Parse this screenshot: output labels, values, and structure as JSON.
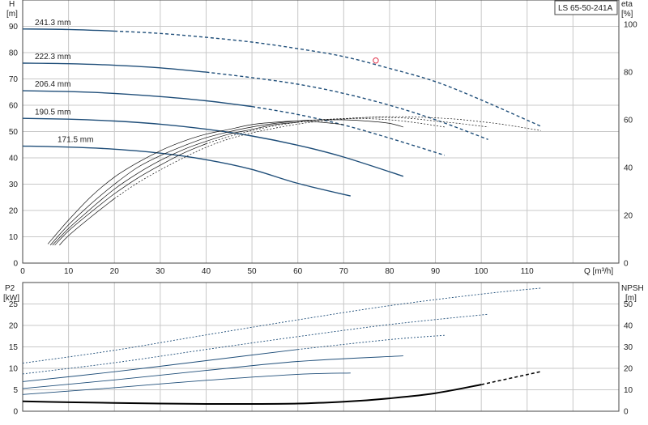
{
  "model_label": "LS 65-50-241A",
  "chart_data": [
    {
      "type": "line",
      "panel": "head-efficiency",
      "ylabel": "H",
      "yunit": "[m]",
      "y2label": "eta",
      "y2unit": "[%]",
      "xlabel": "Q [m³/h]",
      "xlim": [
        0,
        130
      ],
      "ylim": [
        0,
        100
      ],
      "y2lim": [
        0,
        100
      ],
      "x_ticks": [
        "0",
        "10",
        "20",
        "30",
        "40",
        "50",
        "60",
        "70",
        "80",
        "90",
        "100",
        "110"
      ],
      "y_ticks": [
        "0",
        "10",
        "20",
        "30",
        "40",
        "50",
        "60",
        "70",
        "80",
        "90"
      ],
      "y2_ticks": [
        "0",
        "20",
        "40",
        "60",
        "80",
        "100"
      ],
      "grid": true,
      "series": [
        {
          "name": "241.3 mm",
          "q": [
            0,
            10,
            20,
            30,
            40,
            50,
            60,
            70,
            80,
            90,
            100,
            113
          ],
          "h": [
            89,
            88.8,
            88.2,
            87.3,
            85.8,
            84,
            81.5,
            78.5,
            74,
            69,
            62,
            52
          ],
          "solid_to": 20
        },
        {
          "name": "222.3 mm",
          "q": [
            0,
            10,
            20,
            30,
            40,
            50,
            60,
            70,
            80,
            90,
            101.5
          ],
          "h": [
            76,
            75.8,
            75.2,
            74.2,
            72.6,
            70.5,
            68,
            64.5,
            60,
            54.5,
            47
          ],
          "solid_to": 40
        },
        {
          "name": "206.4 mm",
          "q": [
            0,
            10,
            20,
            30,
            40,
            50,
            60,
            70,
            80,
            92
          ],
          "h": [
            65.5,
            65.2,
            64.5,
            63.3,
            61.7,
            59.5,
            56.5,
            52.5,
            47.5,
            41
          ],
          "solid_to": 50
        },
        {
          "name": "190.5 mm",
          "q": [
            0,
            10,
            20,
            30,
            40,
            50,
            60,
            70,
            83
          ],
          "h": [
            55,
            54.7,
            54,
            52.8,
            50.9,
            48.3,
            44.8,
            40.3,
            33
          ],
          "solid_to": 83
        },
        {
          "name": "171.5 mm",
          "q": [
            0,
            10,
            20,
            30,
            40,
            50,
            60,
            71.5
          ],
          "h": [
            44.5,
            44.1,
            43.3,
            41.8,
            39.3,
            35.6,
            30.3,
            25.5
          ],
          "solid_to": 71.5
        }
      ],
      "efficiency_series": [
        {
          "q": [
            5.5,
            10,
            15,
            20,
            25,
            30,
            35,
            40,
            45,
            50,
            55,
            60,
            65,
            70
          ],
          "eta": [
            8,
            18,
            28,
            36,
            42,
            47,
            51,
            54,
            56,
            58,
            59,
            59.5,
            59,
            58
          ],
          "solid_to": 70
        },
        {
          "q": [
            6,
            10,
            15,
            20,
            25,
            30,
            35,
            40,
            45,
            50,
            55,
            60,
            65,
            70,
            75,
            80,
            83
          ],
          "eta": [
            7.5,
            16,
            25,
            33,
            40,
            45,
            49,
            52.5,
            55,
            57,
            58.5,
            59.5,
            60,
            60,
            59.5,
            58.5,
            57
          ],
          "solid_to": 83
        },
        {
          "q": [
            6.5,
            10,
            15,
            20,
            25,
            30,
            35,
            40,
            45,
            50,
            55,
            60,
            65,
            70,
            75,
            80,
            85,
            92
          ],
          "eta": [
            7.5,
            14.5,
            23,
            31,
            37.5,
            43,
            47.5,
            51,
            54,
            56,
            58,
            59,
            60,
            60.5,
            60.5,
            60,
            59,
            57
          ],
          "solid_to": 60
        },
        {
          "q": [
            7,
            10,
            15,
            20,
            25,
            30,
            35,
            40,
            45,
            50,
            55,
            60,
            65,
            70,
            75,
            80,
            85,
            90,
            95,
            101.5
          ],
          "eta": [
            7.5,
            13.5,
            21.5,
            29,
            35.5,
            41,
            46,
            50,
            53,
            55.5,
            57.5,
            59,
            60,
            60.5,
            61,
            61,
            60.5,
            59.5,
            58.5,
            57
          ],
          "solid_to": 40
        },
        {
          "q": [
            8,
            10,
            15,
            20,
            25,
            30,
            35,
            40,
            45,
            50,
            55,
            60,
            65,
            70,
            75,
            80,
            85,
            90,
            95,
            100,
            105,
            113
          ],
          "eta": [
            7.5,
            11.5,
            19.5,
            27,
            33.5,
            39,
            44,
            48.5,
            52,
            54.5,
            56.5,
            58.2,
            59.5,
            60.3,
            61,
            61.3,
            61.2,
            60.8,
            60.2,
            59.2,
            58,
            55.5
          ],
          "solid_to": 20
        }
      ],
      "duty_point": {
        "q": 77,
        "h": 77
      }
    },
    {
      "type": "line",
      "panel": "power-npsh",
      "ylabel": "P2",
      "yunit": "[kW]",
      "y2label": "NPSH",
      "y2unit": "[m]",
      "xlim": [
        0,
        130
      ],
      "ylim": [
        0,
        30
      ],
      "y2lim": [
        0,
        60
      ],
      "y_ticks": [
        "0",
        "5",
        "10",
        "15",
        "20",
        "25"
      ],
      "y2_ticks": [
        "0",
        "10",
        "20",
        "30",
        "40",
        "50"
      ],
      "grid": true,
      "series": [
        {
          "name": "241.3 mm",
          "q": [
            0,
            20,
            40,
            60,
            80,
            100,
            113
          ],
          "p2": [
            11.2,
            14.2,
            17.8,
            21.3,
            24.6,
            27.3,
            28.7
          ],
          "solid_to": 0
        },
        {
          "name": "222.3 mm",
          "q": [
            0,
            20,
            40,
            60,
            80,
            101.5
          ],
          "p2": [
            8.7,
            11.3,
            14.4,
            17.4,
            20.2,
            22.6
          ],
          "solid_to": 0
        },
        {
          "name": "206.4 mm",
          "q": [
            0,
            20,
            40,
            60,
            80,
            92
          ],
          "p2": [
            6.9,
            9.2,
            11.8,
            14.4,
            16.7,
            17.7
          ],
          "solid_to": 60
        },
        {
          "name": "190.5 mm",
          "q": [
            0,
            20,
            40,
            60,
            83
          ],
          "p2": [
            5.3,
            7.3,
            9.5,
            11.6,
            12.9
          ],
          "solid_to": 83
        },
        {
          "name": "171.5 mm",
          "q": [
            0,
            20,
            40,
            60,
            71.5
          ],
          "p2": [
            3.9,
            5.5,
            7.2,
            8.6,
            8.9
          ],
          "solid_to": 71.5
        }
      ],
      "npsh": {
        "q": [
          0,
          10,
          20,
          30,
          40,
          50,
          60,
          70,
          80,
          90,
          100,
          113
        ],
        "m": [
          4.6,
          4.2,
          3.9,
          3.6,
          3.4,
          3.4,
          3.6,
          4.4,
          6,
          8.4,
          12.4,
          18.5
        ],
        "solid_to": 100
      }
    }
  ]
}
